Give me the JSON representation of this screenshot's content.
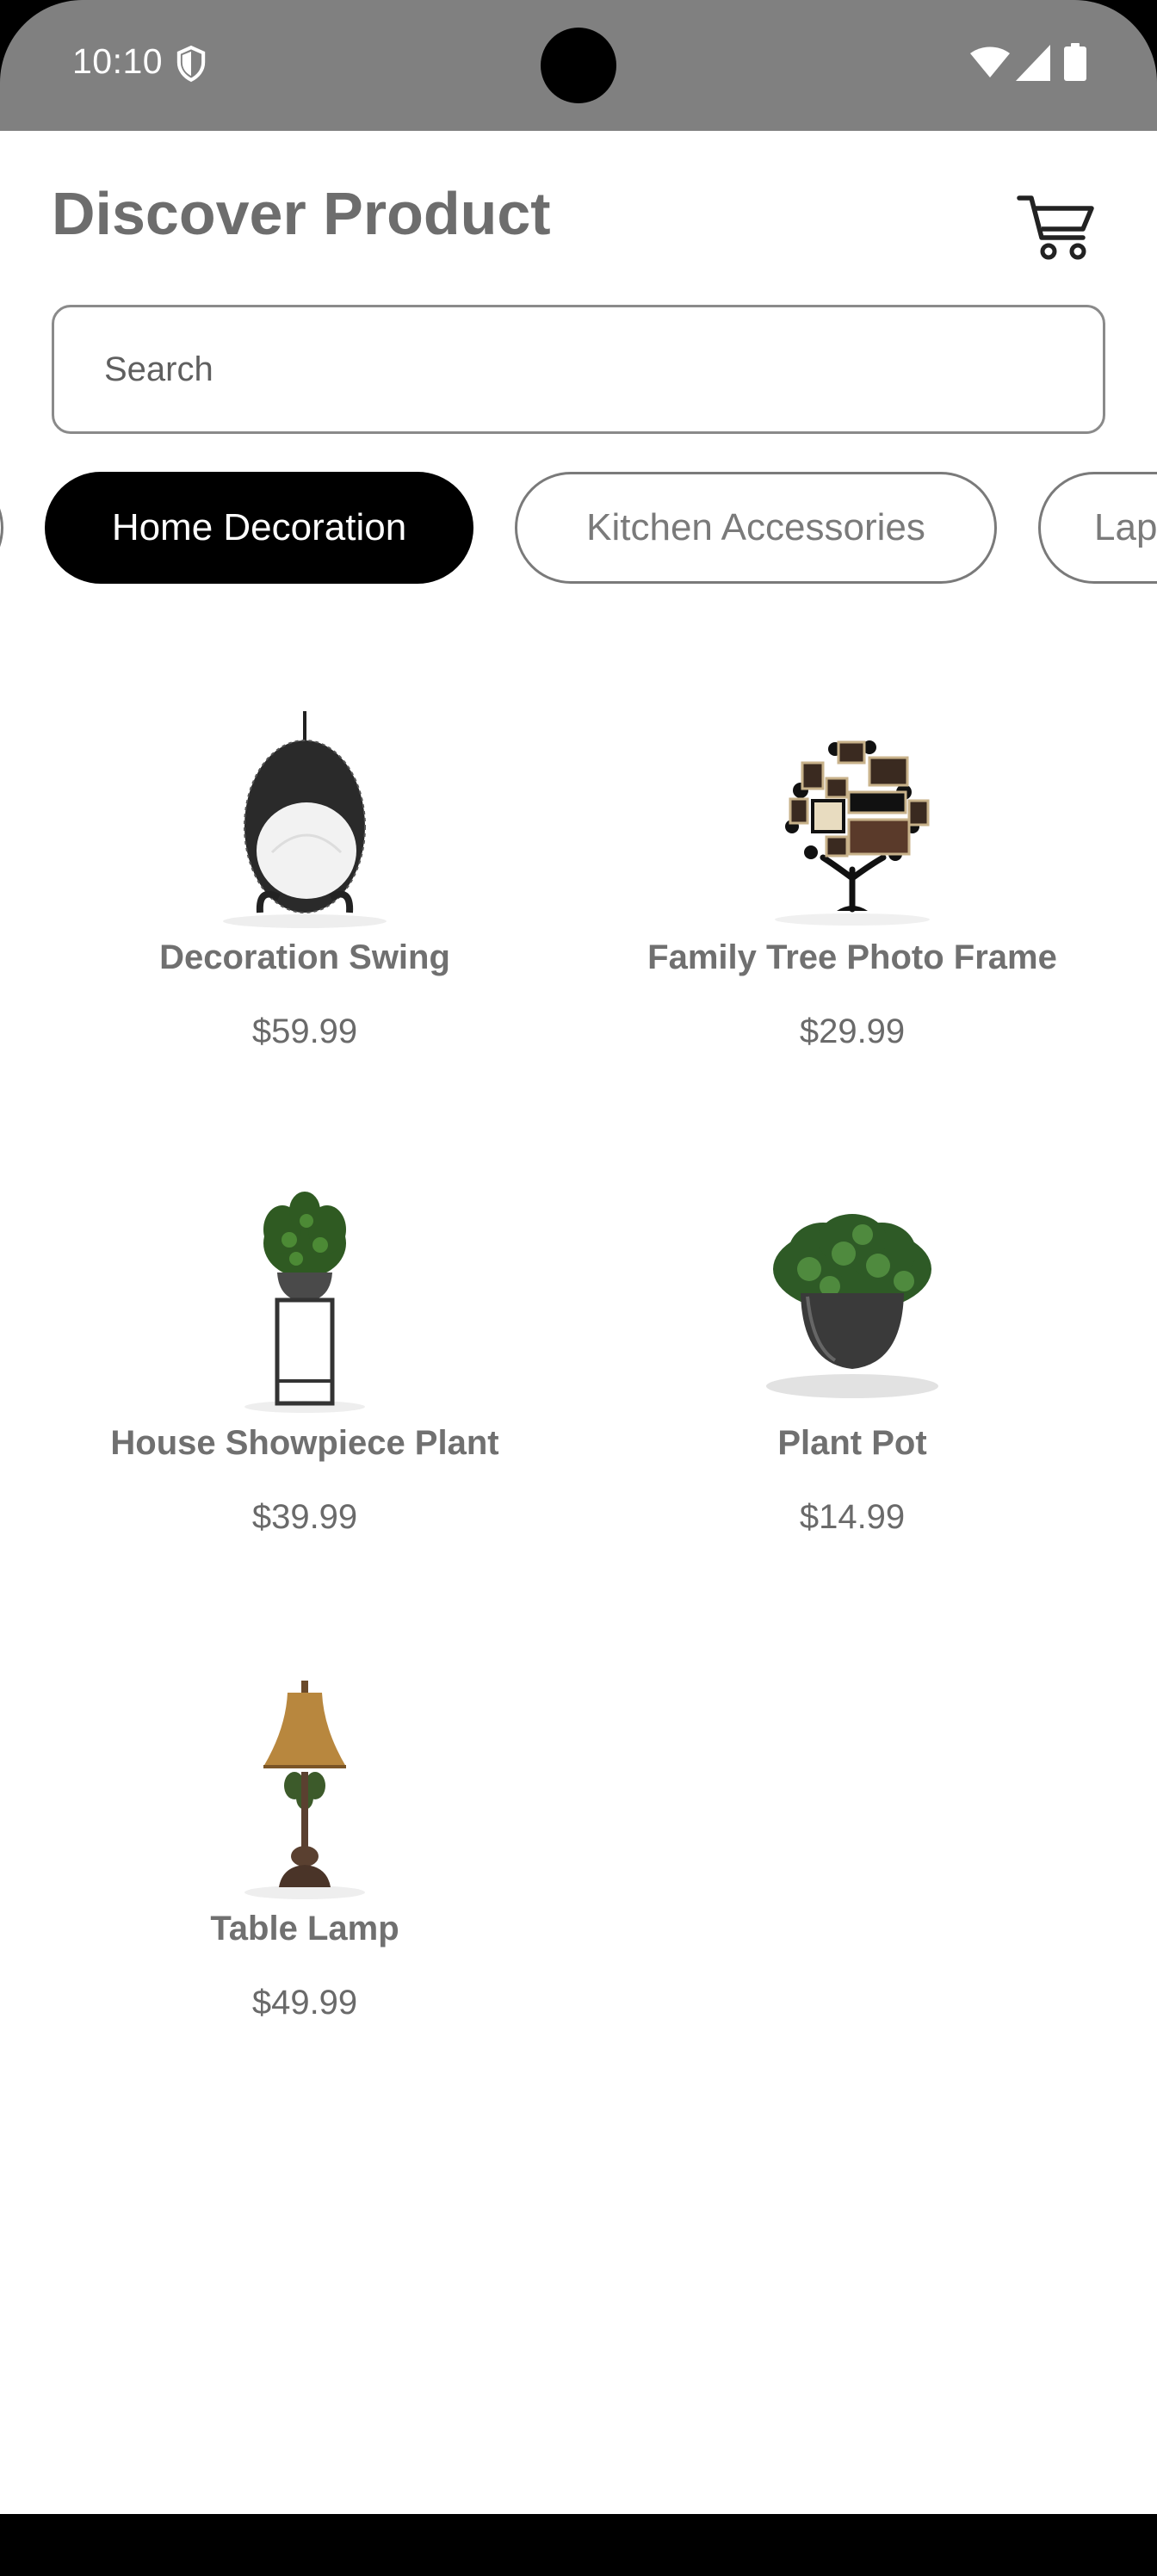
{
  "status_bar": {
    "time": "10:10",
    "icons": [
      "shield-icon",
      "wifi-icon",
      "cell-signal-icon",
      "battery-icon"
    ],
    "color": "#808080"
  },
  "header": {
    "title": "Discover Product",
    "cart_icon": "shopping-cart-icon"
  },
  "search": {
    "placeholder": "Search",
    "value": ""
  },
  "categories": [
    {
      "label": "",
      "active": false
    },
    {
      "label": "Home Decoration",
      "active": true
    },
    {
      "label": "Kitchen Accessories",
      "active": false
    },
    {
      "label": "Laptops",
      "active": false
    }
  ],
  "products": [
    {
      "name": "Decoration Swing",
      "price": "$59.99",
      "image": "hanging-egg-swing-chair"
    },
    {
      "name": "Family Tree Photo Frame",
      "price": "$29.99",
      "image": "family-tree-photo-frame"
    },
    {
      "name": "House Showpiece Plant",
      "price": "$39.99",
      "image": "potted-plant-on-stand"
    },
    {
      "name": "Plant Pot",
      "price": "$14.99",
      "image": "plant-in-dark-pot"
    },
    {
      "name": "Table Lamp",
      "price": "$49.99",
      "image": "table-lamp"
    }
  ],
  "colors": {
    "active_chip": "#000000",
    "title_text": "#6d6d6d",
    "border": "#8a8a8a"
  }
}
